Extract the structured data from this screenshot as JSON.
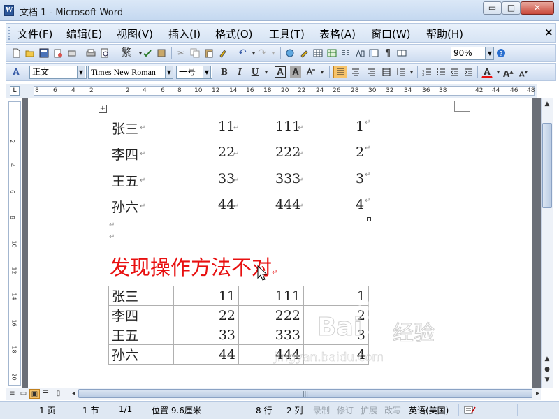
{
  "window": {
    "title": "文档 1 - Microsoft Word",
    "app_icon_text": "W",
    "min_glyph": "▭",
    "max_glyph": "□",
    "close_glyph": "✕"
  },
  "menu": {
    "items": [
      "文件(F)",
      "编辑(E)",
      "视图(V)",
      "插入(I)",
      "格式(O)",
      "工具(T)",
      "表格(A)",
      "窗口(W)",
      "帮助(H)"
    ],
    "close_glyph": "×"
  },
  "toolbar1": {
    "zoom_value": "90%",
    "traditional_label": "繁"
  },
  "toolbar2": {
    "style_value": "正文",
    "font_value": "Times New Roman",
    "size_value": "一号",
    "bold": "B",
    "italic": "I",
    "underline": "U",
    "char_border": "A",
    "char_shading": "A",
    "font_color": "A"
  },
  "ruler": {
    "numbers": [
      "8",
      "6",
      "4",
      "2",
      "2",
      "4",
      "6",
      "8",
      "10",
      "12",
      "14",
      "16",
      "18",
      "20",
      "22",
      "24",
      "26",
      "28",
      "30",
      "32",
      "34",
      "36",
      "38",
      "42",
      "44",
      "46",
      "48"
    ],
    "corner": "L"
  },
  "vruler": {
    "numbers": [
      "2",
      "4",
      "6",
      "8",
      "10",
      "12",
      "14",
      "16",
      "18",
      "20"
    ]
  },
  "document": {
    "tabbed_rows": [
      {
        "name": "张三",
        "a": "11",
        "b": "111",
        "c": "1"
      },
      {
        "name": "李四",
        "a": "22",
        "b": "222",
        "c": "2"
      },
      {
        "name": "王五",
        "a": "33",
        "b": "333",
        "c": "3"
      },
      {
        "name": "孙六",
        "a": "44",
        "b": "444",
        "c": "4"
      }
    ],
    "arrow_mark": "↵",
    "heading": "发现操作方法不对",
    "table_rows": [
      {
        "name": "张三",
        "a": "11",
        "b": "111",
        "c": "1"
      },
      {
        "name": "李四",
        "a": "22",
        "b": "222",
        "c": "2"
      },
      {
        "name": "王五",
        "a": "33",
        "b": "333",
        "c": "3"
      },
      {
        "name": "孙六",
        "a": "44",
        "b": "444",
        "c": "4"
      }
    ],
    "watermark_brand": "Bai",
    "watermark_cn": "经验",
    "watermark_url": "jingyan.baidu.com"
  },
  "status": {
    "page": "1 页",
    "section": "1 节",
    "page_of": "1/1",
    "position": "位置 9.6厘米",
    "line": "8 行",
    "col": "2 列",
    "rec": "录制",
    "trk": "修订",
    "ext": "扩展",
    "ovr": "改写",
    "lang": "英语(美国)"
  },
  "colors": {
    "heading_red": "#e81010",
    "doc_background": "#6b6f77"
  }
}
